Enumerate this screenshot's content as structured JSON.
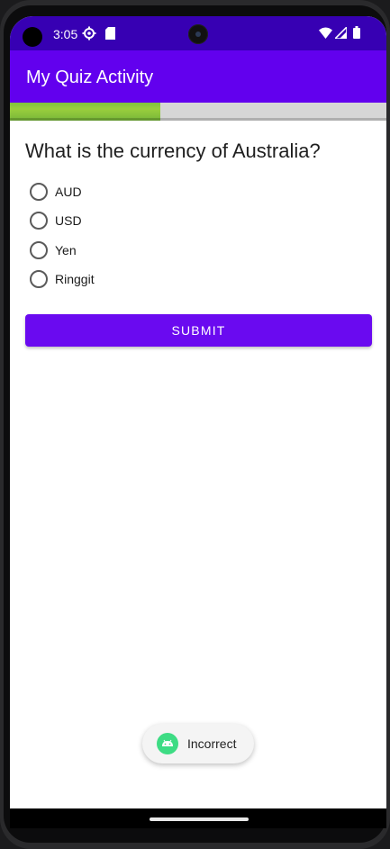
{
  "status_bar": {
    "time": "3:05",
    "icons": [
      "gear-icon",
      "sim-card-icon",
      "wifi-icon",
      "signal-icon",
      "battery-icon"
    ],
    "color": "#3700b3"
  },
  "app_bar": {
    "title": "My Quiz Activity",
    "color": "#6200ee"
  },
  "progress": {
    "value_fraction": 0.4,
    "fill_color": "#8bc34a"
  },
  "quiz": {
    "question": "What is the currency of Australia?",
    "options": [
      {
        "label": "AUD",
        "selected": false
      },
      {
        "label": "USD",
        "selected": false
      },
      {
        "label": "Yen",
        "selected": false
      },
      {
        "label": "Ringgit",
        "selected": false
      }
    ],
    "submit_label": "SUBMIT"
  },
  "toast": {
    "icon": "android-icon",
    "message": "Incorrect"
  }
}
